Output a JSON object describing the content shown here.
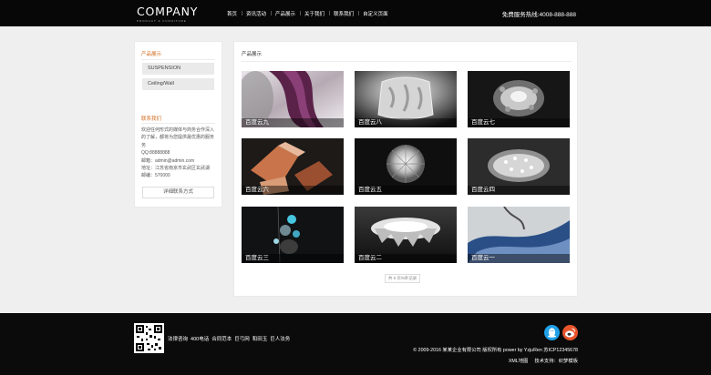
{
  "header": {
    "logo_text": "COMPANY",
    "logo_sub": "PRODUCT & FURNITURE",
    "nav": [
      "首页",
      "资讯活动",
      "产品展示",
      "关于我们",
      "联系我们",
      "自定义页面"
    ],
    "hotline": "免费服务热线:4008-888-888"
  },
  "sidebar": {
    "products_title": "产品展示",
    "categories": [
      "SUSPENSION",
      "Ceiling/Wall"
    ],
    "contact_title": "联系我们",
    "contact_lines": [
      "欢迎任何形式的媒体与商务合作深入",
      "的了解，都将为您提供最优惠的服务",
      "务",
      "QQ:88888888",
      "邮箱：admin@admin.com",
      "地址：江苏省南京市玄武区玄武湖",
      "邮编：570000"
    ],
    "detail_button": "详细联系方式"
  },
  "main": {
    "title": "产品展示",
    "products": [
      {
        "name": "百度云九",
        "thumb": "curve-purple"
      },
      {
        "name": "百度云八",
        "thumb": "glass-lamp"
      },
      {
        "name": "百度云七",
        "thumb": "crystal-dark"
      },
      {
        "name": "百度云六",
        "thumb": "bowls-orange"
      },
      {
        "name": "百度云五",
        "thumb": "globe"
      },
      {
        "name": "百度云四",
        "thumb": "crystal-light"
      },
      {
        "name": "百度云三",
        "thumb": "pendant-blue"
      },
      {
        "name": "百度云二",
        "thumb": "chandelier"
      },
      {
        "name": "百度云一",
        "thumb": "blue-fabric"
      }
    ],
    "pager": "共 9 页/9条记录"
  },
  "footer": {
    "links": [
      "法律咨询",
      "400电话",
      "合同范本",
      "巨弓网",
      "和田玉",
      "巨人法务"
    ],
    "copyright": "© 2009-2016 某某企业有限公司 版权所有 power by YzjuRen   苏ICP12345678",
    "sub_links": [
      "XML地图",
      "技术支持：织梦模板"
    ],
    "social": [
      {
        "icon": "qq-icon",
        "color": "#1fa1e8"
      },
      {
        "icon": "weibo-icon",
        "color": "#e8542b"
      }
    ]
  },
  "colors": {
    "accent": "#d36b1e",
    "header_bg": "#070707",
    "footer_bg": "#0b0b0b",
    "page_bg": "#efefef"
  }
}
